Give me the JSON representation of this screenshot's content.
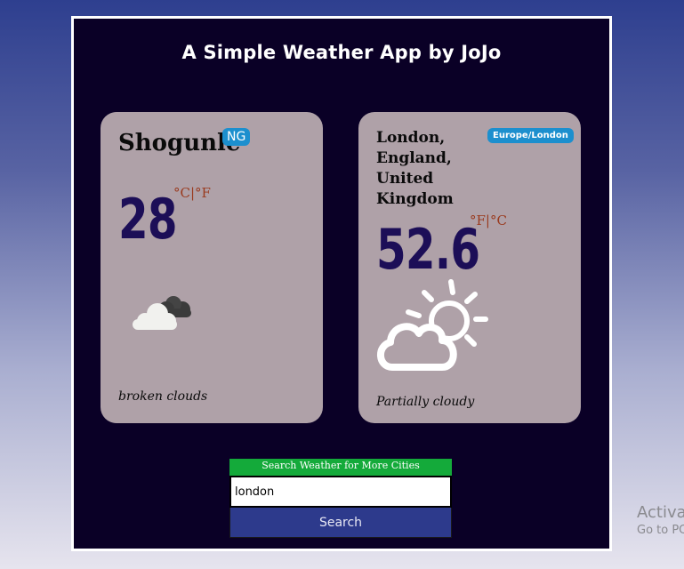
{
  "app": {
    "title": "A Simple Weather App by JoJo"
  },
  "cards": [
    {
      "city": "Shogunle",
      "badge": "NG",
      "temperature": "28",
      "units": "°C|°F",
      "icon": "broken-clouds-icon",
      "description": "broken clouds"
    },
    {
      "city": "London, England, United Kingdom",
      "badge": "Europe/London",
      "temperature": "52.6",
      "units": "°F|°C",
      "icon": "partly-cloudy-icon",
      "description": "Partially cloudy"
    }
  ],
  "search": {
    "label": "Search Weather for More Cities",
    "value": "london",
    "button_label": "Search"
  },
  "watermark": {
    "title": "Activa",
    "subtitle": "Go to PC"
  },
  "colors": {
    "app_background": "#0a0026",
    "card_background": "#afa1a8",
    "temperature": "#1c0e57",
    "units": "#9a3a1e",
    "badge": "#1c8fce",
    "search_label": "#14aa3a",
    "search_button": "#2d3a8c"
  }
}
